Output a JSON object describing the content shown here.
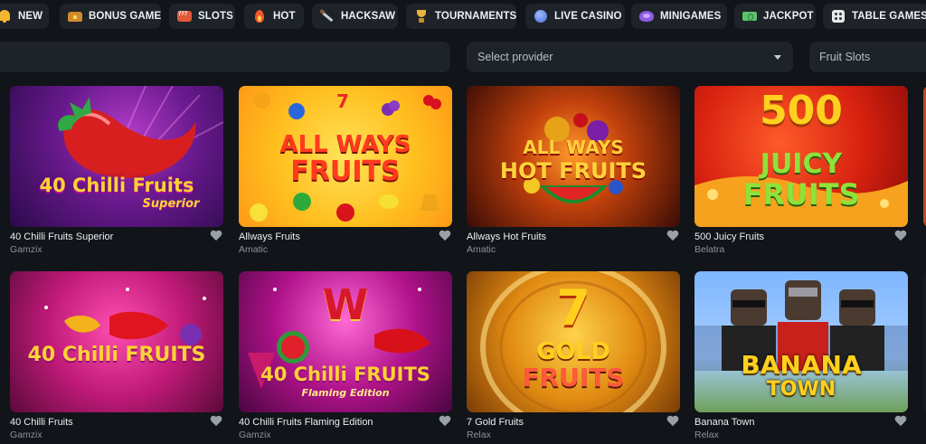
{
  "categories": [
    {
      "label": "NEW",
      "icon": "bell-icon"
    },
    {
      "label": "BONUS GAME",
      "icon": "treasure-chest-icon"
    },
    {
      "label": "SLOTS",
      "icon": "slot-machine-icon"
    },
    {
      "label": "HOT",
      "icon": "fire-icon"
    },
    {
      "label": "HACKSAW",
      "icon": "saw-icon"
    },
    {
      "label": "TOURNAMENTS",
      "icon": "trophy-icon"
    },
    {
      "label": "LIVE CASINO",
      "icon": "globe-icon"
    },
    {
      "label": "MINIGAMES",
      "icon": "heart-icon"
    },
    {
      "label": "JACKPOT",
      "icon": "cash-icon"
    },
    {
      "label": "TABLE GAMES",
      "icon": "dice-icon"
    }
  ],
  "filters": {
    "provider_placeholder": "Select provider",
    "category_value": "Fruit Slots"
  },
  "games": [
    {
      "name": "40 Chilli Fruits Superior",
      "provider": "Gamzix",
      "art": [
        "40 Chilli Fruits",
        "Superior"
      ]
    },
    {
      "name": "Allways Fruits",
      "provider": "Amatic",
      "art": [
        "ALL WAYS",
        "FRUITS"
      ]
    },
    {
      "name": "Allways Hot Fruits",
      "provider": "Amatic",
      "art": [
        "ALL WAYS",
        "HOT FRUITS"
      ]
    },
    {
      "name": "500 Juicy Fruits",
      "provider": "Belatra",
      "art": [
        "500",
        "JUICY",
        "FRUITS"
      ]
    },
    {
      "name": "40 Chilli Fruits",
      "provider": "Gamzix",
      "art": [
        "40 Chilli FRUITS"
      ]
    },
    {
      "name": "40 Chilli Fruits Flaming Edition",
      "provider": "Gamzix",
      "art": [
        "W",
        "40 Chilli FRUITS",
        "Flaming Edition"
      ]
    },
    {
      "name": "7 Gold Fruits",
      "provider": "Relax",
      "art": [
        "7",
        "GOLD",
        "FRUITS"
      ]
    },
    {
      "name": "Banana Town",
      "provider": "Relax",
      "art": [
        "BANANA",
        "TOWN"
      ]
    }
  ],
  "colors": {
    "background": "#111419",
    "surface": "#1e2229",
    "muted_text": "#8d939c"
  }
}
